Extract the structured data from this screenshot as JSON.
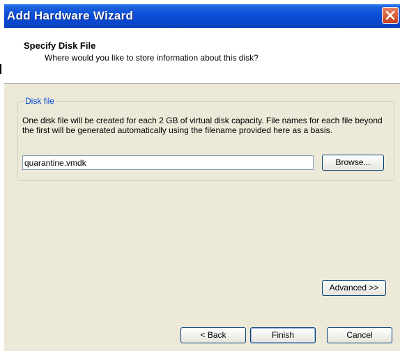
{
  "window": {
    "title": "Add Hardware Wizard",
    "close_glyph": "×"
  },
  "header": {
    "title": "Specify Disk File",
    "subtitle": "Where would you like to store information about this disk?"
  },
  "disk_group": {
    "legend": "Disk file",
    "description": "One disk file will be created for each 2 GB of virtual disk capacity. File names for each file beyond the first will be generated automatically using the filename provided here as a basis.",
    "filename_value": "quarantine.vmdk",
    "browse_label": "Browse..."
  },
  "buttons": {
    "advanced": "Advanced >>",
    "back": "< Back",
    "finish": "Finish",
    "cancel": "Cancel"
  },
  "colors": {
    "titlebar": "#0a4ad6",
    "dialog_bg": "#ece9d8",
    "legend_text": "#0046d5"
  }
}
